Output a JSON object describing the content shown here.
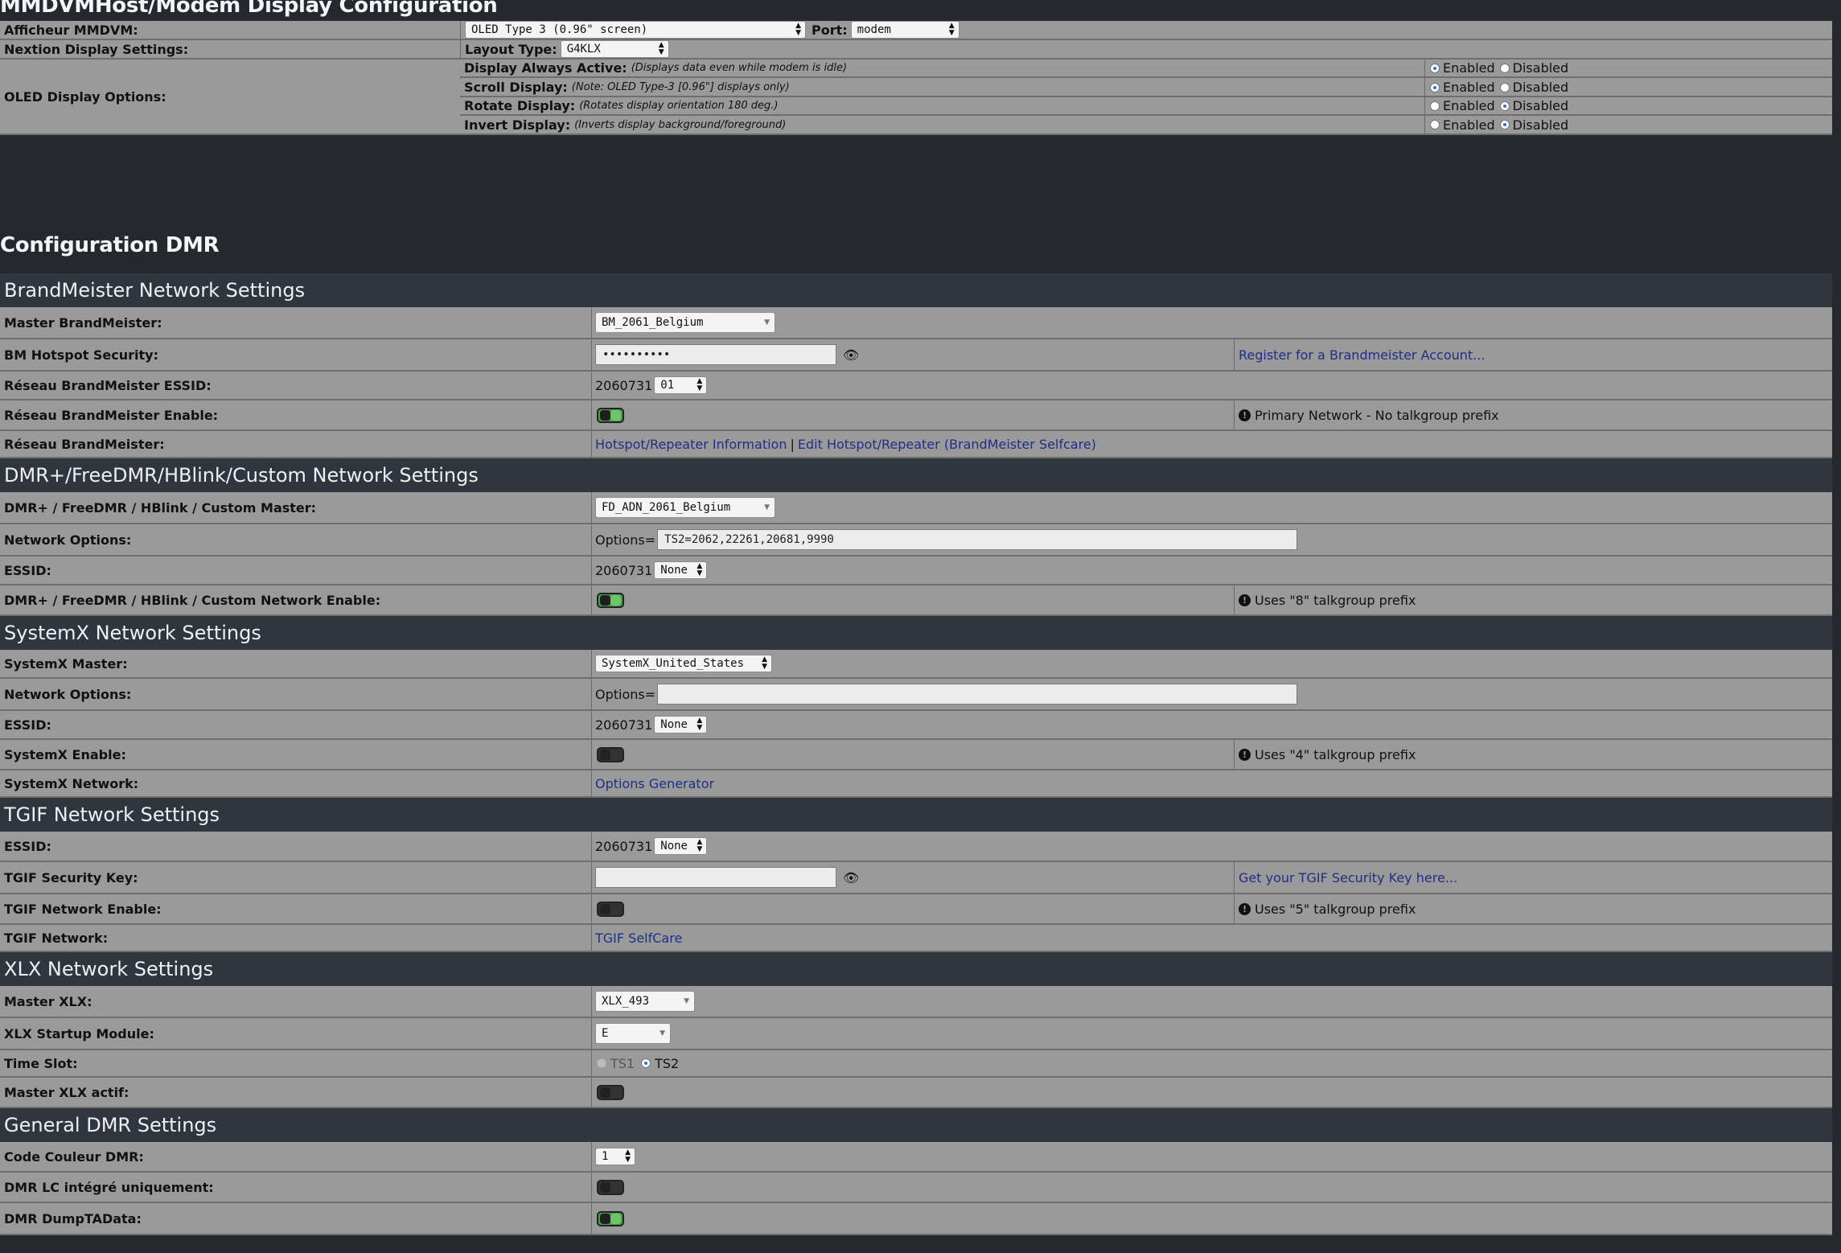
{
  "mmdvm": {
    "title": "MMDVMHost/Modem Display Configuration",
    "afficheur_label": "Afficheur MMDVM:",
    "afficheur_value": "OLED Type 3 (0.96\" screen)",
    "port_label": "Port:",
    "port_value": "modem",
    "nextion_label": "Nextion Display Settings:",
    "layout_label": "Layout Type:",
    "layout_value": "G4KLX",
    "oled_label": "OLED Display Options:",
    "enabled": "Enabled",
    "disabled": "Disabled",
    "options": [
      {
        "label": "Display Always Active:",
        "note": "(Displays data even while modem is idle)",
        "state": "Enabled"
      },
      {
        "label": "Scroll Display:",
        "note": "(Note: OLED Type-3 [0.96\"] displays only)",
        "state": "Enabled"
      },
      {
        "label": "Rotate Display:",
        "note": "(Rotates display orientation 180 deg.)",
        "state": "Disabled"
      },
      {
        "label": "Invert Display:",
        "note": "(Inverts display background/foreground)",
        "state": "Disabled"
      }
    ]
  },
  "dmr": {
    "title": "Configuration DMR",
    "bm": {
      "header": "BrandMeister Network Settings",
      "master_label": "Master BrandMeister:",
      "master_value": "BM_2061_Belgium",
      "security_label": "BM Hotspot Security:",
      "security_value": "••••••••••",
      "register_link": "Register for a Brandmeister Account...",
      "essid_label": "Réseau BrandMeister ESSID:",
      "essid_prefix": "2060731",
      "essid_value": "01",
      "enable_label": "Réseau BrandMeister Enable:",
      "enable_on": true,
      "enable_note": "Primary Network - No talkgroup prefix",
      "network_label": "Réseau BrandMeister:",
      "link_info": "Hotspot/Repeater Information",
      "link_sep": "|",
      "link_edit": "Edit Hotspot/Repeater (BrandMeister Selfcare)"
    },
    "dmrplus": {
      "header": "DMR+/FreeDMR/HBlink/Custom Network Settings",
      "master_label": "DMR+ / FreeDMR / HBlink / Custom Master:",
      "master_value": "FD_ADN_2061_Belgium",
      "options_label": "Network Options:",
      "options_prefix": "Options=",
      "options_value": "TS2=2062,22261,20681,9990",
      "essid_label": "ESSID:",
      "essid_prefix": "2060731",
      "essid_value": "None",
      "enable_label": "DMR+ / FreeDMR / HBlink / Custom Network Enable:",
      "enable_on": true,
      "enable_note": "Uses \"8\" talkgroup prefix"
    },
    "systemx": {
      "header": "SystemX Network Settings",
      "master_label": "SystemX Master:",
      "master_value": "SystemX_United_States",
      "options_label": "Network Options:",
      "options_prefix": "Options=",
      "options_value": "",
      "essid_label": "ESSID:",
      "essid_prefix": "2060731",
      "essid_value": "None",
      "enable_label": "SystemX Enable:",
      "enable_on": false,
      "enable_note": "Uses \"4\" talkgroup prefix",
      "network_label": "SystemX Network:",
      "network_link": "Options Generator"
    },
    "tgif": {
      "header": "TGIF Network Settings",
      "essid_label": "ESSID:",
      "essid_prefix": "2060731",
      "essid_value": "None",
      "key_label": "TGIF Security Key:",
      "key_value": "",
      "key_link": "Get your TGIF Security Key here...",
      "enable_label": "TGIF Network Enable:",
      "enable_on": false,
      "enable_note": "Uses \"5\" talkgroup prefix",
      "network_label": "TGIF Network:",
      "network_link": "TGIF SelfCare"
    },
    "xlx": {
      "header": "XLX Network Settings",
      "master_label": "Master XLX:",
      "master_value": "XLX_493",
      "module_label": "XLX Startup Module:",
      "module_value": "E",
      "timeslot_label": "Time Slot:",
      "ts1": "TS1",
      "ts2": "TS2",
      "timeslot_selected": "TS2",
      "active_label": "Master XLX actif:",
      "active_on": false
    },
    "general": {
      "header": "General DMR Settings",
      "color_label": "Code Couleur DMR:",
      "color_value": "1",
      "lc_label": "DMR LC intégré uniquement:",
      "lc_on": false,
      "dump_label": "DMR DumpTAData:",
      "dump_on": true
    }
  },
  "icons": {
    "eye": "eye-icon",
    "info": "exclamation-circle-icon",
    "select_arrows": "updown-arrows-icon"
  }
}
